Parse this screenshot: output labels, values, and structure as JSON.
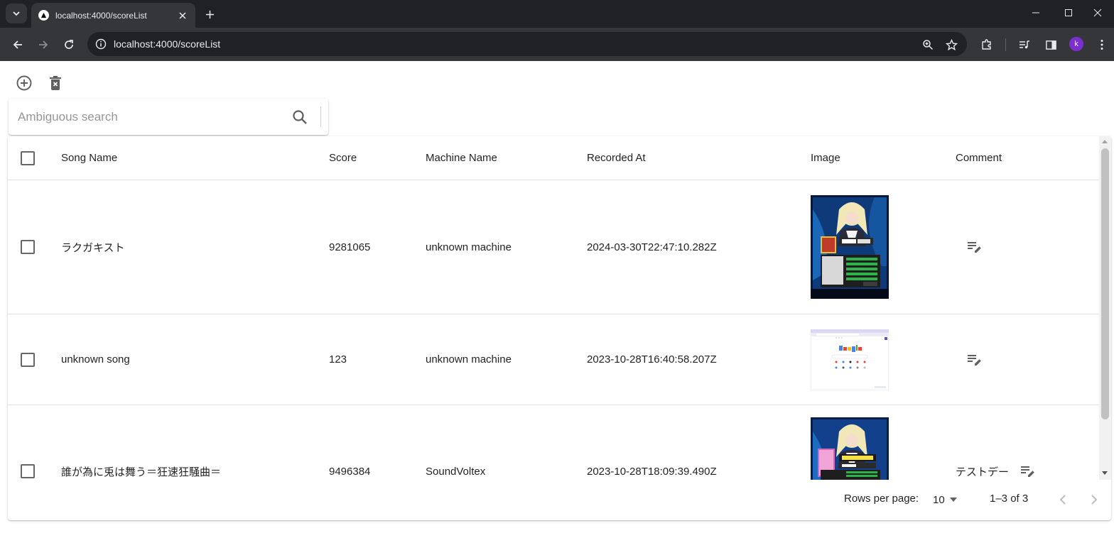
{
  "browser": {
    "tab_title": "localhost:4000/scoreList",
    "url": "localhost:4000/scoreList",
    "profile_initial": "k"
  },
  "search": {
    "placeholder": "Ambiguous search",
    "value": ""
  },
  "table": {
    "columns": [
      "Song Name",
      "Score",
      "Machine Name",
      "Recorded At",
      "Image",
      "Comment"
    ],
    "rows": [
      {
        "song_name": "ラクガキスト",
        "score": "9281065",
        "machine_name": "unknown machine",
        "recorded_at": "2024-03-30T22:47:10.282Z",
        "image": "arcade-score-photo",
        "comment": ""
      },
      {
        "song_name": "unknown song",
        "score": "123",
        "machine_name": "unknown machine",
        "recorded_at": "2023-10-28T16:40:58.207Z",
        "image": "google-homepage-screenshot",
        "comment": ""
      },
      {
        "song_name": "誰が為に兎は舞う＝狂速狂騒曲＝",
        "score": "9496384",
        "machine_name": "SoundVoltex",
        "recorded_at": "2023-10-28T18:09:39.490Z",
        "image": "arcade-score-photo",
        "comment": "テストデー"
      }
    ]
  },
  "pagination": {
    "rows_per_page_label": "Rows per page:",
    "rows_per_page_value": "10",
    "range_text": "1–3 of 3"
  },
  "colors": {
    "chrome_dark": "#202124",
    "chrome_toolbar": "#35363a",
    "icon_gray": "#5f5f5f",
    "profile": "#7b2fd1"
  }
}
